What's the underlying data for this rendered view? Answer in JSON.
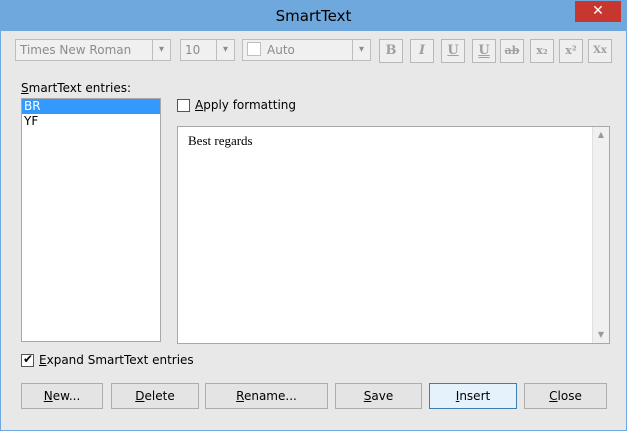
{
  "window": {
    "title": "SmartText",
    "close_glyph": "✕"
  },
  "toolbar": {
    "font_name": "Times New Roman",
    "font_size": "10",
    "color": "Auto",
    "buttons": [
      {
        "name": "bold",
        "glyph": "B"
      },
      {
        "name": "italic",
        "glyph": "I"
      },
      {
        "name": "underline",
        "glyph": "U"
      },
      {
        "name": "double-underline",
        "glyph": "U"
      },
      {
        "name": "strikethrough",
        "glyph": "ab"
      },
      {
        "name": "subscript",
        "glyph": "x₂"
      },
      {
        "name": "superscript",
        "glyph": "x²"
      },
      {
        "name": "clear-format",
        "glyph": "Xx"
      }
    ]
  },
  "entries": {
    "label_first": "S",
    "label_rest": "martText entries:",
    "items": [
      "BR",
      "YF"
    ],
    "selected_index": 0
  },
  "apply_formatting": {
    "label_first": "A",
    "label_rest": "pply formatting",
    "checked": false
  },
  "editor": {
    "text": "Best regards"
  },
  "expand": {
    "label_first": "E",
    "label_rest": "xpand SmartText entries",
    "checked": true
  },
  "buttons": {
    "new": {
      "u": "N",
      "rest": "ew..."
    },
    "delete": {
      "u": "D",
      "rest": "elete"
    },
    "rename": {
      "u": "R",
      "rest": "ename..."
    },
    "save": {
      "u": "S",
      "rest": "ave"
    },
    "insert": {
      "u": "I",
      "rest": "nsert"
    },
    "close": {
      "u": "C",
      "rest": "lose"
    }
  }
}
